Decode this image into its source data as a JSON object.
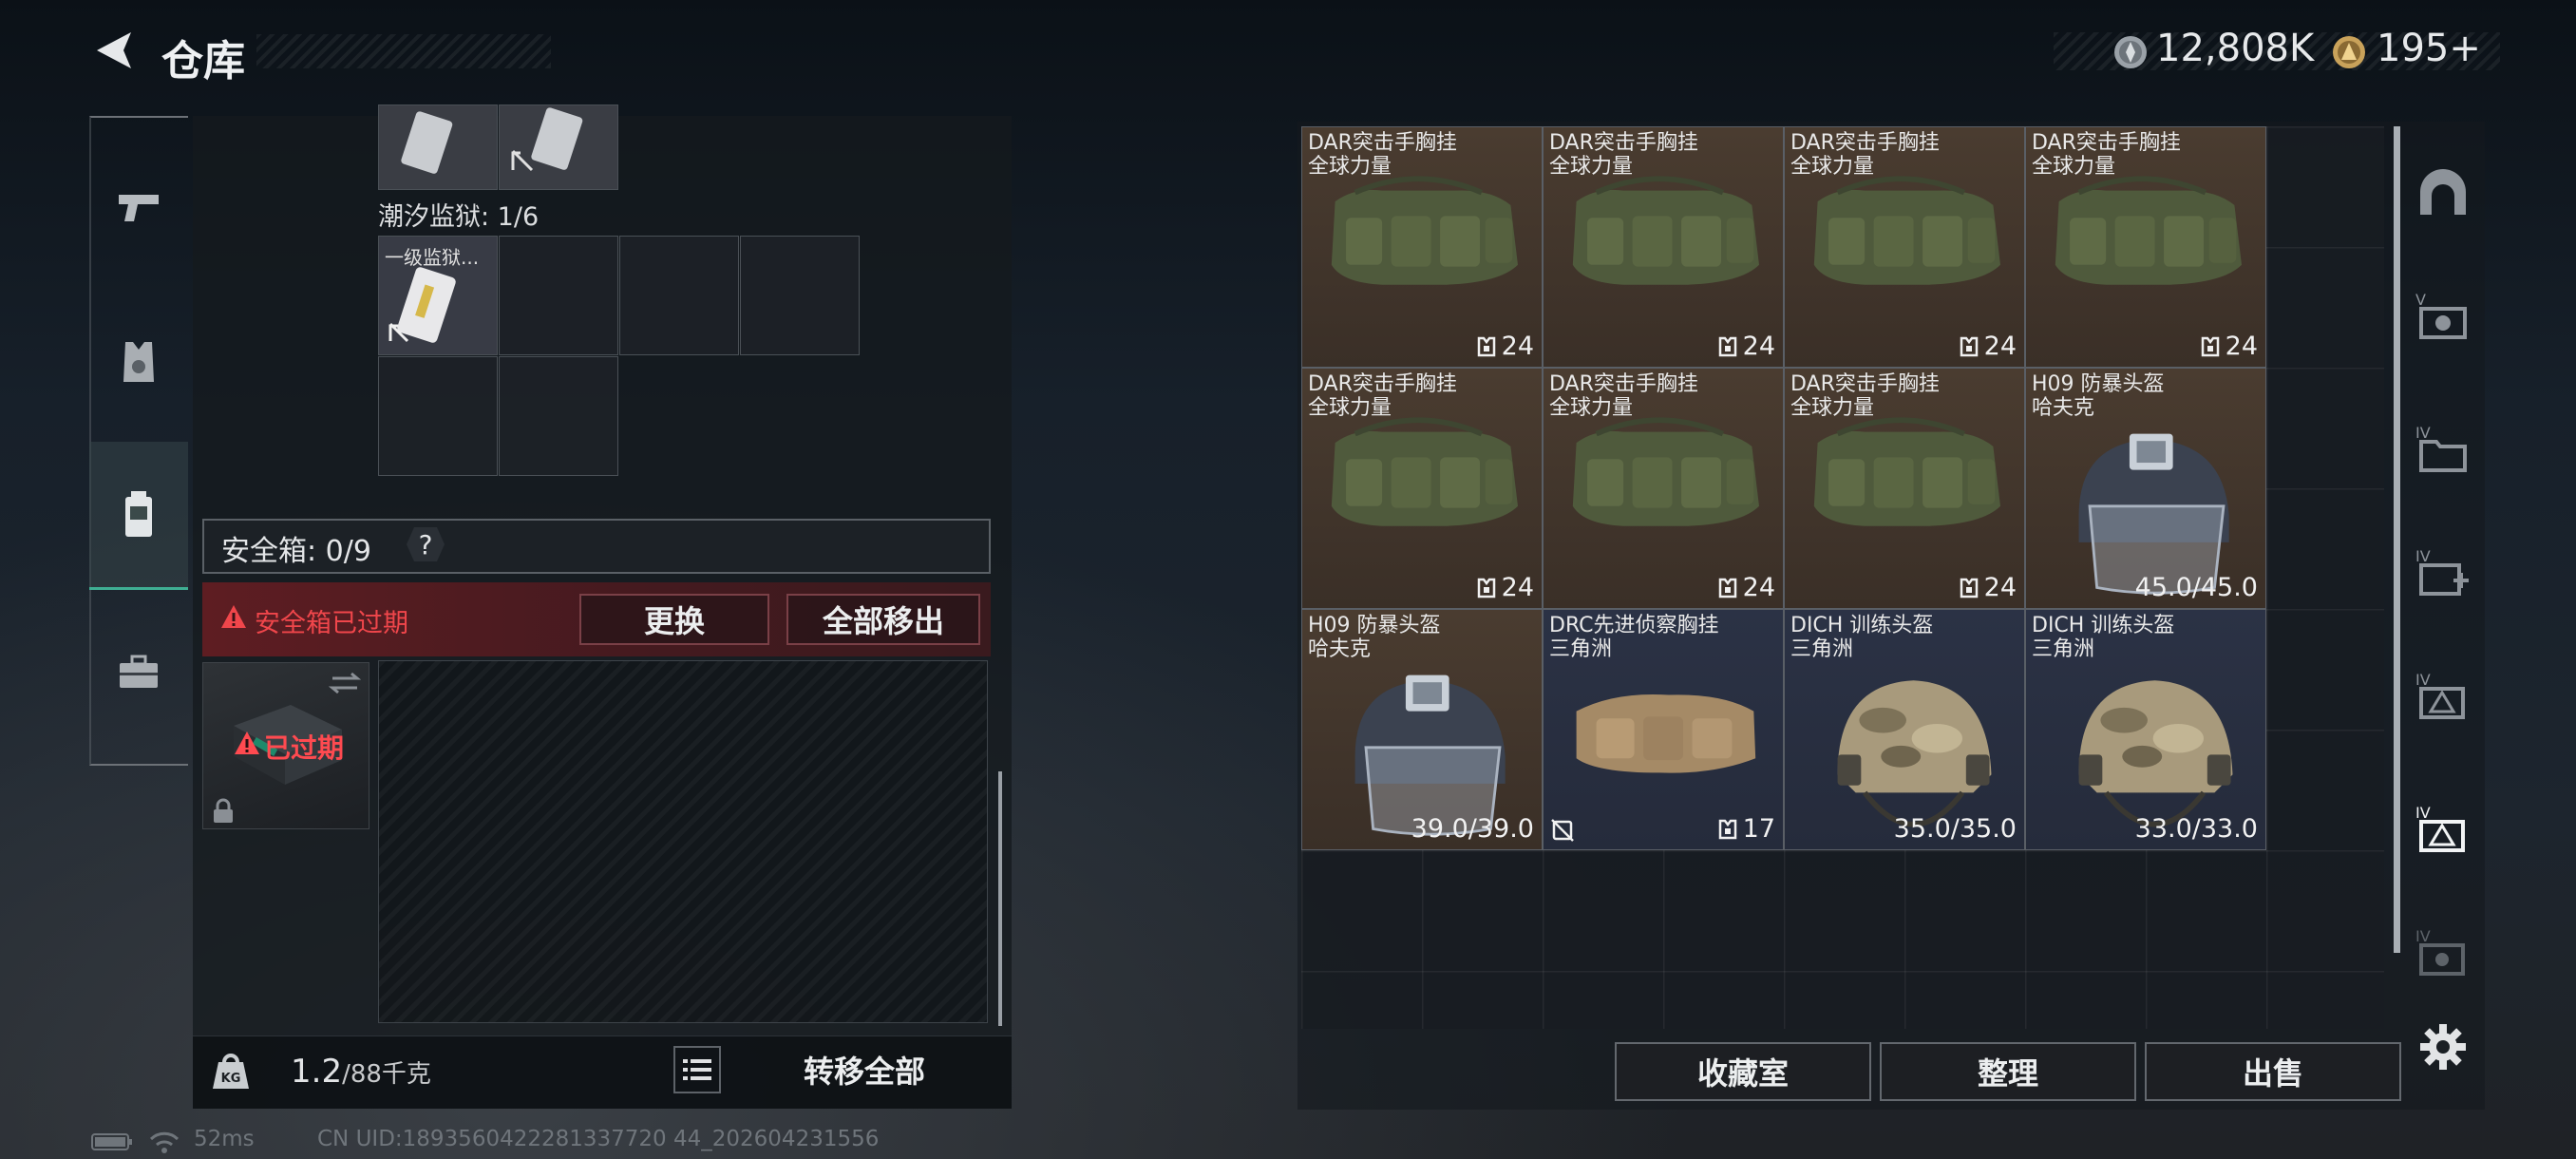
{
  "header": {
    "title": "仓库",
    "back_icon": "back-arrow-icon"
  },
  "currency": [
    {
      "icon": "silver-coin-icon",
      "value": "12,808K"
    },
    {
      "icon": "gold-coin-icon",
      "value": "195+"
    }
  ],
  "tabs": [
    {
      "icon": "pistol-icon"
    },
    {
      "icon": "armor-vest-icon"
    },
    {
      "icon": "backpack-icon",
      "active": true
    },
    {
      "icon": "briefcase-icon"
    }
  ],
  "left": {
    "loadout_label": "潮汐监狱: 1/6",
    "key_item_name": "一级监狱...",
    "safebox_label": "安全箱: 0/9",
    "safebox_help": "?",
    "warning": "安全箱已过期",
    "replace_btn": "更换",
    "remove_all_btn": "全部移出",
    "case_status": "已过期",
    "weight": "1.2",
    "weight_max": "/88千克",
    "transfer_all": "转移全部"
  },
  "stash": {
    "items": [
      {
        "name": "DAR突击手胸挂",
        "brand": "全球力量",
        "value": "24",
        "type": "bag",
        "bg": "brown"
      },
      {
        "name": "DAR突击手胸挂",
        "brand": "全球力量",
        "value": "24",
        "type": "bag",
        "bg": "brown"
      },
      {
        "name": "DAR突击手胸挂",
        "brand": "全球力量",
        "value": "24",
        "type": "bag",
        "bg": "brown"
      },
      {
        "name": "DAR突击手胸挂",
        "brand": "全球力量",
        "value": "24",
        "type": "bag",
        "bg": "brown"
      },
      {
        "name": "DAR突击手胸挂",
        "brand": "全球力量",
        "value": "24",
        "type": "bag",
        "bg": "brown"
      },
      {
        "name": "DAR突击手胸挂",
        "brand": "全球力量",
        "value": "24",
        "type": "bag",
        "bg": "brown"
      },
      {
        "name": "DAR突击手胸挂",
        "brand": "全球力量",
        "value": "24",
        "type": "bag",
        "bg": "brown"
      },
      {
        "name": "H09 防暴头盔",
        "brand": "哈夫克",
        "value": "45.0/45.0",
        "type": "helmet-dark",
        "bg": "brown"
      },
      {
        "name": "H09 防暴头盔",
        "brand": "哈夫克",
        "value": "39.0/39.0",
        "type": "helmet-dark",
        "bg": "brown"
      },
      {
        "name": "DRC先进侦察胸挂",
        "brand": "三角洲",
        "value": "17",
        "type": "tan-bag",
        "bg": "slate"
      },
      {
        "name": "DICH 训练头盔",
        "brand": "三角洲",
        "value": "35.0/35.0",
        "type": "helmet-camo",
        "bg": "slate"
      },
      {
        "name": "DICH 训练头盔",
        "brand": "三角洲",
        "value": "33.0/33.0",
        "type": "helmet-camo",
        "bg": "slate"
      }
    ],
    "collect_btn": "收藏室",
    "sort_btn": "整理",
    "sell_btn": "出售"
  },
  "side_icons": [
    "bunker-icon",
    "storage-v-icon",
    "folder-iv-icon",
    "medkit-iv-icon",
    "triangle-iv-icon",
    "triangle-iv-active-icon",
    "ammo-iv-icon",
    "gear-icon"
  ],
  "status_bar": {
    "ping": "52ms",
    "uid": "CN UID:1893560422281337720 44_202604231556"
  },
  "colors": {
    "accent": "#3fae93",
    "warning": "#f0464b",
    "brown_tile": "#4a3c30",
    "slate_tile": "#2b3245"
  }
}
